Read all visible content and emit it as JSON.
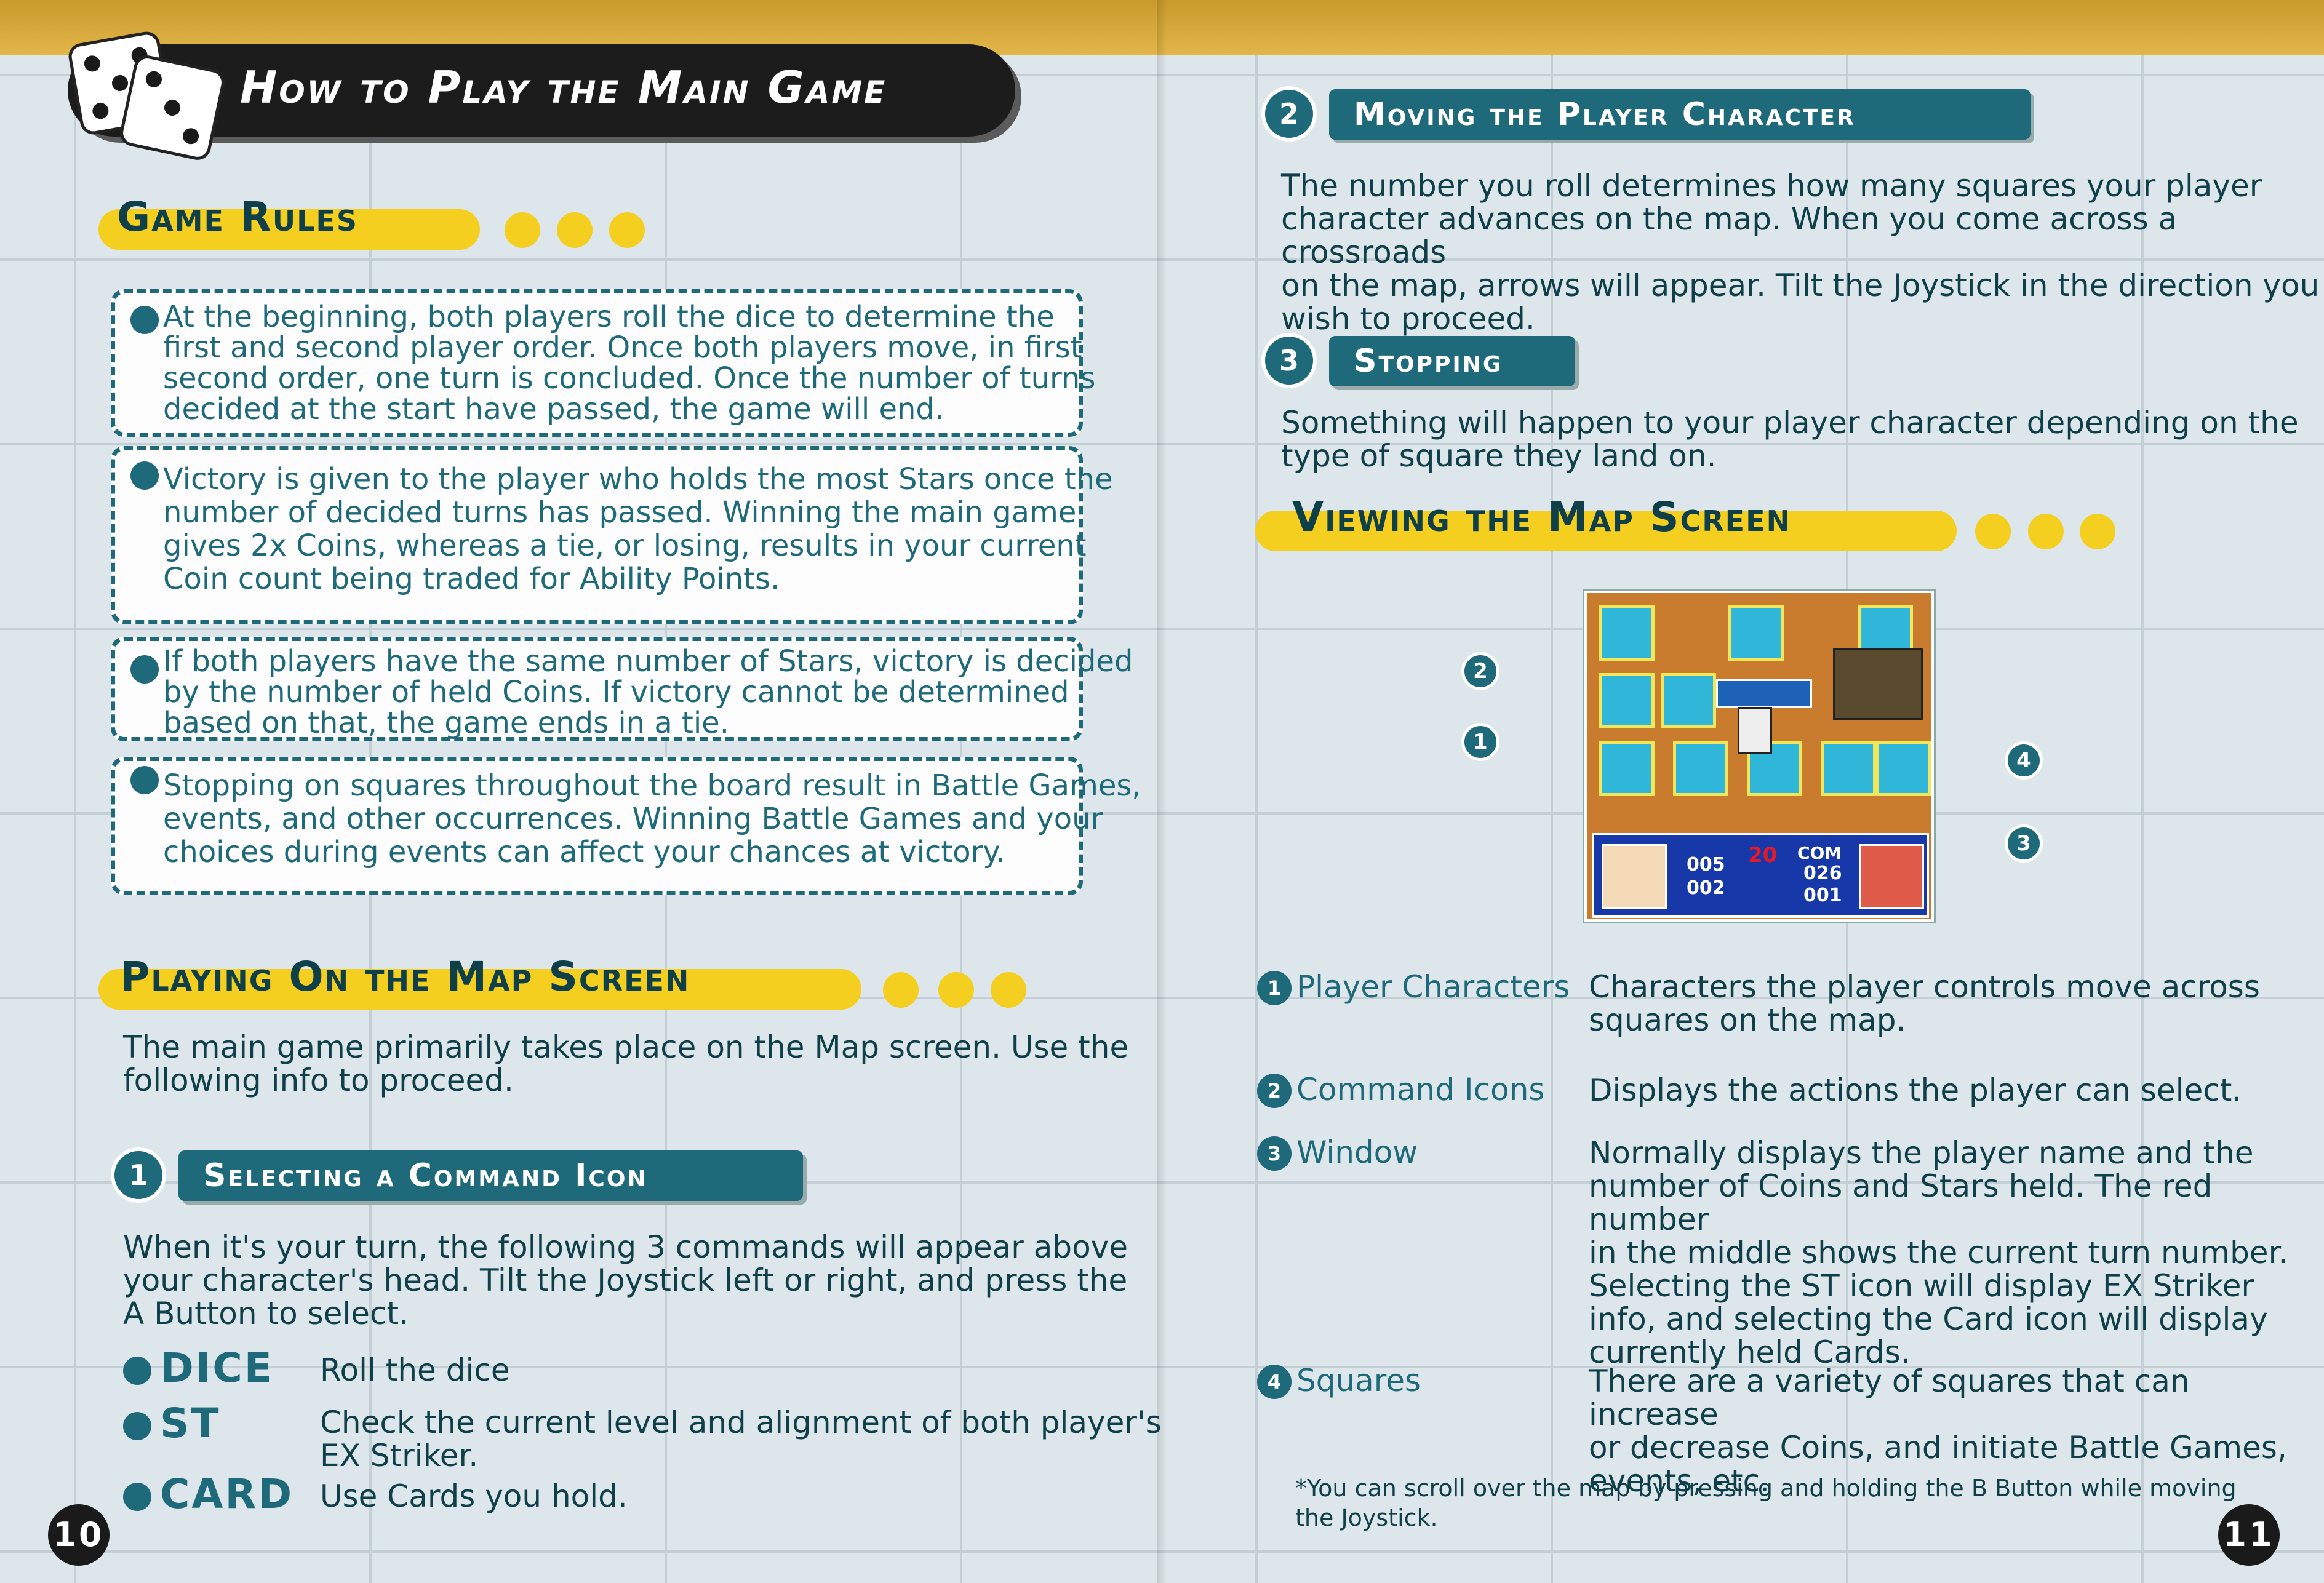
{
  "left_page": {
    "title": "How to Play the Main Game",
    "game_rules_heading": "Game Rules",
    "rules": [
      {
        "lines": [
          "At the beginning, both players roll the dice to determine the",
          "first and second player order. Once both players move, in first",
          "second order, one turn is concluded. Once the number of turns",
          "decided at the start have passed, the game will end."
        ]
      },
      {
        "lines": [
          "Victory is given to the player who holds the most Stars once the",
          "number of decided turns has passed. Winning the main game",
          "gives 2x Coins, whereas a tie, or losing, results in your current",
          "Coin count being traded for Ability Points."
        ]
      },
      {
        "lines": [
          "If both players have the same number of Stars, victory is decided",
          "by the number of held Coins. If victory cannot be determined",
          "based on that, the game ends in a tie."
        ]
      },
      {
        "lines": [
          "Stopping on squares throughout the board result in Battle Games,",
          "events, and other occurrences. Winning Battle Games and your",
          "choices during events can affect your chances at victory."
        ]
      }
    ],
    "map_heading": "Playing On the Map Screen",
    "map_intro": [
      "The main game primarily takes place on the Map screen. Use the",
      "following info to proceed."
    ],
    "step1_number": "1",
    "step1_title": "Selecting a Command Icon",
    "step1_text": [
      "When it's your turn, the following 3 commands will appear above",
      "your character's head. Tilt the Joystick left or right, and press the",
      "A Button to select."
    ],
    "commands": [
      {
        "label": "DICE",
        "desc": [
          "Roll the dice"
        ]
      },
      {
        "label": "ST",
        "desc": [
          "Check the current level and alignment of both player's",
          "EX Striker."
        ]
      },
      {
        "label": "CARD",
        "desc": [
          "Use Cards you hold."
        ]
      }
    ],
    "page_number": "10"
  },
  "right_page": {
    "step2_number": "2",
    "step2_title": "Moving the Player Character",
    "step2_text": [
      "The number you roll determines how many squares your player",
      "character advances on the map. When you come across a crossroads",
      "on the map, arrows will appear. Tilt the Joystick in the direction you",
      "wish to proceed."
    ],
    "step3_number": "3",
    "step3_title": "Stopping",
    "step3_text": [
      "Something will happen to your player character depending on the",
      "type of square they land on."
    ],
    "viewing_heading": "Viewing the Map Screen",
    "screenshot_markers": [
      "2",
      "1",
      "4",
      "3"
    ],
    "screenshot_hud": {
      "left_coins": "005",
      "left_stars": "002",
      "turn": "20",
      "right_label": "COM",
      "right_coins": "026",
      "right_stars": "001"
    },
    "legend": [
      {
        "num": "1",
        "label": "Player Characters",
        "desc": [
          "Characters the player controls move across",
          "squares on the map."
        ]
      },
      {
        "num": "2",
        "label": "Command Icons",
        "desc": [
          "Displays the actions the player can select."
        ]
      },
      {
        "num": "3",
        "label": "Window",
        "desc": [
          "Normally displays the player name and the",
          "number of Coins and Stars held. The red number",
          "in the middle shows the current turn number.",
          "Selecting the ST icon will display EX Striker",
          "info, and selecting the Card icon will display",
          "currently held Cards."
        ]
      },
      {
        "num": "4",
        "label": "Squares",
        "desc": [
          "There are a variety of squares that can increase",
          "or decrease Coins, and initiate Battle Games,",
          "events, etc."
        ]
      }
    ],
    "footnote": [
      "*You can scroll over the map by pressing and holding the B Button while moving",
      "the Joystick."
    ],
    "page_number": "11"
  },
  "colors": {
    "teal": "#1f6a7a",
    "yellow": "#f5cf1f",
    "dark": "#1c1c1c",
    "turn_red": "#e0192b"
  }
}
